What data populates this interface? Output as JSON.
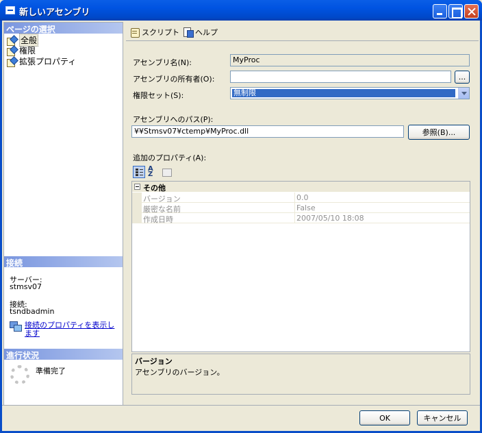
{
  "window": {
    "title": "新しいアセンブリ"
  },
  "left": {
    "pages_header": "ページの選択",
    "pages": [
      {
        "label": "全般",
        "selected": true
      },
      {
        "label": "権限",
        "selected": false
      },
      {
        "label": "拡張プロパティ",
        "selected": false
      }
    ],
    "connection_header": "接続",
    "server_label": "サーバー:",
    "server_value": "stmsv07",
    "connection_label": "接続:",
    "connection_value": "tsndbadmin",
    "connection_link": "接続のプロパティを表示します",
    "progress_header": "進行状況",
    "progress_status": "準備完了"
  },
  "toolbar": {
    "script_label": "スクリプト",
    "help_label": "ヘルプ"
  },
  "form": {
    "assembly_name_label": "アセンブリ名(N):",
    "assembly_name_value": "MyProc",
    "owner_label": "アセンブリの所有者(O):",
    "owner_value": "",
    "browse_owner_label": "...",
    "permission_label": "権限セット(S):",
    "permission_value": "無制限",
    "path_label": "アセンブリへのパス(P):",
    "path_value": "¥¥Stmsv07¥ctemp¥MyProc.dll",
    "browse_label": "参照(B)...",
    "extra_props_label": "追加のプロパティ(A):"
  },
  "property_grid": {
    "category": "その他",
    "rows": [
      {
        "name": "バージョン",
        "value": "0.0"
      },
      {
        "name": "厳密な名前",
        "value": "False"
      },
      {
        "name": "作成日時",
        "value": "2007/05/10 18:08"
      }
    ],
    "sort_az_label": "A Z"
  },
  "description": {
    "title": "バージョン",
    "text": "アセンブリのバージョン。"
  },
  "buttons": {
    "ok": "OK",
    "cancel": "キャンセル"
  }
}
